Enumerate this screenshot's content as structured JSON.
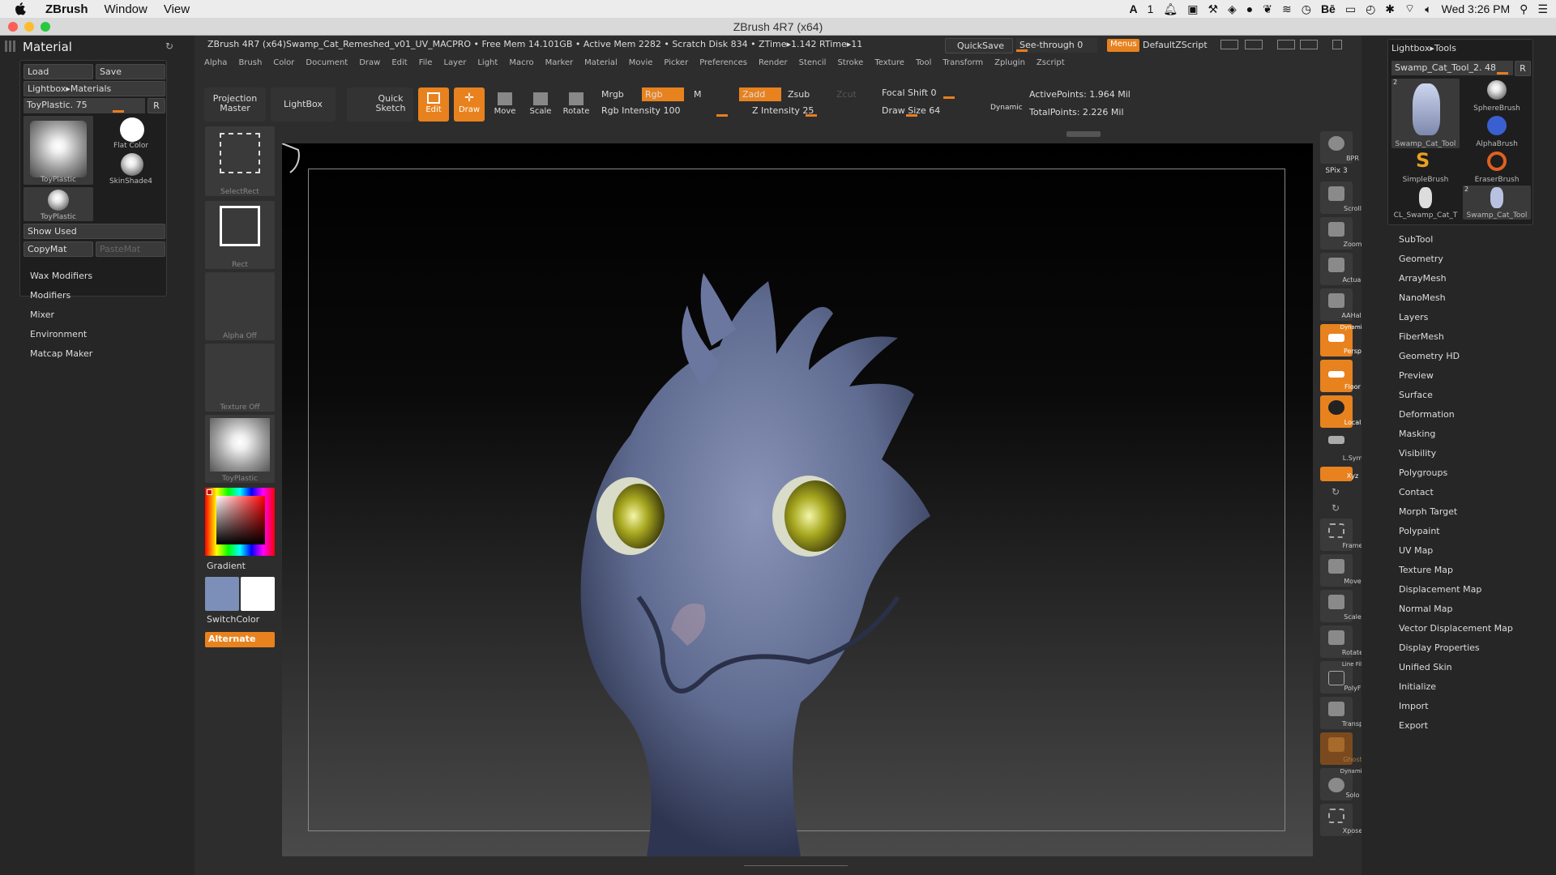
{
  "mac": {
    "app_name": "ZBrush",
    "menus": [
      "Window",
      "View"
    ],
    "clock": "Wed 3:26 PM",
    "adobe_count": "1"
  },
  "window_title": "ZBrush 4R7 (x64)",
  "left_panel": {
    "title": "Material",
    "load": "Load",
    "save": "Save",
    "lightbox": "Lightbox▸Materials",
    "current": "ToyPlastic. 75",
    "r": "R",
    "thumbs": [
      "ToyPlastic",
      "Flat Color",
      "SkinShade4",
      "ToyPlastic"
    ],
    "show_used": "Show Used",
    "copymat": "CopyMat",
    "pastemat": "PasteMat",
    "menu": [
      "Wax Modifiers",
      "Modifiers",
      "Mixer",
      "Environment",
      "Matcap Maker"
    ]
  },
  "top": {
    "info": "ZBrush 4R7 (x64)Swamp_Cat_Remeshed_v01_UV_MACPRO  • Free Mem 14.101GB • Active Mem 2282 • Scratch Disk 834 • ZTime▸1.142 RTime▸11",
    "quicksave": "QuickSave",
    "seethrough": "See-through  0",
    "menus_btn": "Menus",
    "script": "DefaultZScript",
    "menu_items": [
      "Alpha",
      "Brush",
      "Color",
      "Document",
      "Draw",
      "Edit",
      "File",
      "Layer",
      "Light",
      "Macro",
      "Marker",
      "Material",
      "Movie",
      "Picker",
      "Preferences",
      "Render",
      "Stencil",
      "Stroke",
      "Texture",
      "Tool",
      "Transform",
      "Zplugin",
      "Zscript"
    ]
  },
  "toolbar": {
    "projection": "Projection Master",
    "lightbox": "LightBox",
    "quicksketch": "Quick Sketch",
    "edit": "Edit",
    "draw": "Draw",
    "move": "Move",
    "scale": "Scale",
    "rotate": "Rotate",
    "mrgb": "Mrgb",
    "rgb": "Rgb",
    "m": "M",
    "zadd": "Zadd",
    "zsub": "Zsub",
    "zcut": "Zcut",
    "rgb_intensity": "Rgb Intensity 100",
    "z_intensity": "Z Intensity 25",
    "focal_shift": "Focal Shift 0",
    "draw_size": "Draw Size 64",
    "dynamic": "Dynamic",
    "active_points": "ActivePoints: 1.964 Mil",
    "total_points": "TotalPoints: 2.226 Mil"
  },
  "left_shelf": {
    "select_rect": "SelectRect",
    "rect": "Rect",
    "alpha_off": "Alpha  Off",
    "texture_off": "Texture  Off",
    "material": "ToyPlastic",
    "gradient": "Gradient",
    "switchcolor": "SwitchColor",
    "alternate": "Alternate",
    "colors": {
      "main": "#7b8fb8",
      "secondary": "#ffffff",
      "accent": "#e8821e"
    }
  },
  "right_shelf": [
    "BPR",
    "SPix 3",
    "Scroll",
    "Zoom",
    "Actual",
    "AAHalf",
    "Persp",
    "Floor",
    "Local",
    "L.Sym",
    "Xyz",
    "Frame",
    "Move",
    "Scale",
    "Rotate",
    "PolyF",
    "Transp",
    "Ghost",
    "Solo",
    "Xpose"
  ],
  "right_shelf_labels": {
    "persp_top": "Dynamic",
    "linefill": "Line Fill",
    "solo_top": "Dynamic"
  },
  "right_panel": {
    "header": "Lightbox▸Tools",
    "tool": "Swamp_Cat_Tool_2. 48",
    "r": "R",
    "tools": [
      "Swamp_Cat_Tool",
      "SphereBrush",
      "AlphaBrush",
      "SimpleBrush",
      "EraserBrush",
      "CL_Swamp_Cat_T",
      "Swamp_Cat_Tool"
    ],
    "tool_badges": [
      "2",
      "2"
    ],
    "menu": [
      "SubTool",
      "Geometry",
      "ArrayMesh",
      "NanoMesh",
      "Layers",
      "FiberMesh",
      "Geometry HD",
      "Preview",
      "Surface",
      "Deformation",
      "Masking",
      "Visibility",
      "Polygroups",
      "Contact",
      "Morph Target",
      "Polypaint",
      "UV Map",
      "Texture Map",
      "Displacement Map",
      "Normal Map",
      "Vector Displacement Map",
      "Display Properties",
      "Unified Skin",
      "Initialize",
      "Import",
      "Export"
    ]
  }
}
